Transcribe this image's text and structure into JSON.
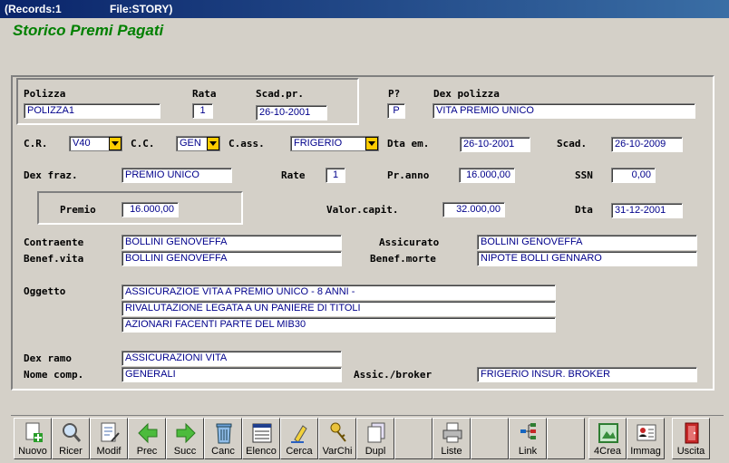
{
  "titlebar": {
    "records": "(Records:1",
    "file": "File:STORY)"
  },
  "title": "Storico Premi Pagati",
  "labels": {
    "polizza": "Polizza",
    "rata": "Rata",
    "scad_pr": "Scad.pr.",
    "p_q": "P?",
    "dex_polizza": "Dex polizza",
    "cr": "C.R.",
    "cc": "C.C.",
    "cass": "C.ass.",
    "dta_em": "Dta em.",
    "scad": "Scad.",
    "dex_fraz": "Dex fraz.",
    "rate": "Rate",
    "pr_anno": "Pr.anno",
    "ssn": "SSN",
    "premio": "Premio",
    "valor_capit": "Valor.capit.",
    "dta": "Dta",
    "contraente": "Contraente",
    "assicurato": "Assicurato",
    "benef_vita": "Benef.vita",
    "benef_morte": "Benef.morte",
    "oggetto": "Oggetto",
    "dex_ramo": "Dex ramo",
    "nome_comp": "Nome comp.",
    "assic_broker": "Assic./broker"
  },
  "values": {
    "polizza": "POLIZZA1",
    "rata": "1",
    "scad_pr": "26-10-2001",
    "p": "P",
    "dex_polizza": "VITA PREMIO UNICO",
    "cr": "V40",
    "cc": "GEN",
    "cass": "FRIGERIO",
    "dta_em": "26-10-2001",
    "scad": "26-10-2009",
    "dex_fraz": "PREMIO UNICO",
    "rate": "1",
    "pr_anno": "16.000,00",
    "ssn": "0,00",
    "premio": "16.000,00",
    "valor_capit": "32.000,00",
    "dta": "31-12-2001",
    "contraente": "BOLLINI GENOVEFFA",
    "assicurato": "BOLLINI GENOVEFFA",
    "benef_vita": "BOLLINI GENOVEFFA",
    "benef_morte": "NIPOTE BOLLI GENNARO",
    "oggetto1": "ASSICURAZIOE VITA A PREMIO UNICO - 8 ANNI -",
    "oggetto2": "RIVALUTAZIONE LEGATA A UN PANIERE DI TITOLI",
    "oggetto3": "AZIONARI FACENTI PARTE DEL MIB30",
    "dex_ramo": "ASSICURAZIONI VITA",
    "nome_comp": "GENERALI",
    "assic_broker": "FRIGERIO INSUR. BROKER"
  },
  "toolbar": {
    "nuovo": "Nuovo",
    "ricer": "Ricer",
    "modif": "Modif",
    "prec": "Prec",
    "succ": "Succ",
    "canc": "Canc",
    "elenco": "Elenco",
    "cerca": "Cerca",
    "varchi": "VarChi",
    "dupl": "Dupl",
    "liste": "Liste",
    "link": "Link",
    "crea4": "4Crea",
    "immag": "Immag",
    "uscita": "Uscita"
  }
}
